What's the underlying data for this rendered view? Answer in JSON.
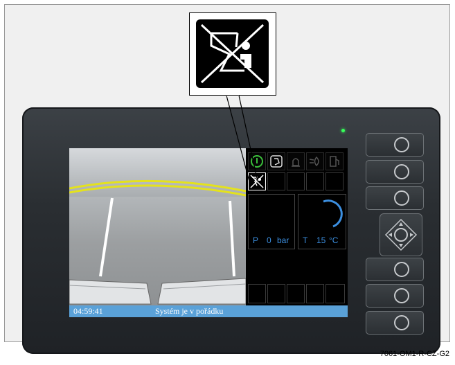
{
  "status_bar": {
    "time": "04:59:41",
    "message": "Systém je v pořádku"
  },
  "gauges": {
    "pressure": {
      "label": "P",
      "value": "0",
      "unit": "bar"
    },
    "temperature": {
      "label": "T",
      "value": "15",
      "unit": "°C"
    }
  },
  "figure_code": "7061-OM1-R-CZ-G2",
  "colors": {
    "status_bar": "#5aa1d8",
    "gauge_text": "#3c8fe0",
    "indicator_active": "#3bbf3b",
    "led": "#36ff5a"
  },
  "icons": {
    "top_row": [
      "power-icon",
      "driver-seat-icon",
      "warning-light-icon",
      "headlight-icon",
      "fuel-pump-icon"
    ],
    "highlighted": "driver-absent-crossed-icon"
  }
}
